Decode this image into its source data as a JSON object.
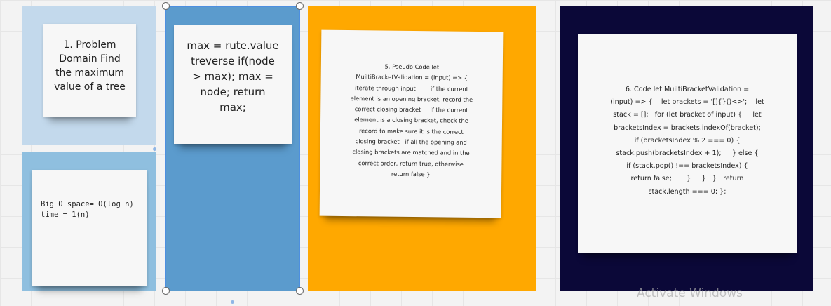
{
  "canvas": {
    "colors": {
      "light_blue_top": "#c3d9ec",
      "light_blue_bottom": "#8fbfdf",
      "mid_blue": "#5b9bcd",
      "orange": "#ffa800",
      "navy": "#0b0838",
      "note": "#f7f7f7",
      "selection": "#4d8fe0"
    }
  },
  "notes": {
    "problem_domain": "1. Problem\nDomain Find\nthe maximum\nvalue of a tree",
    "big_o": "Big O space= O(log n)\ntime = 1(n)",
    "algorithm": "max = rute.value\ntreverse if(node\n> max); max =\nnode; return\nmax;",
    "pseudo_code": "5. Pseudo Code let\nMuiltiBracketValidation = (input) => {\niterate through input        if the current\nelement is an opening bracket, record the\ncorrect closing bracket     if the current\nelement is a closing bracket, check the\nrecord to make sure it is the correct\nclosing bracket   if all the opening and\nclosing brackets are matched and in the\ncorrect order, return true, otherwise\nreturn false }",
    "code": "6. Code let MuiltiBracketValidation =\n(input) => {    let brackets = '[]{}()<>';    let\nstack = [];   for (let bracket of input) {     let\nbracketsIndex = brackets.indexOf(bracket);\nif (bracketsIndex % 2 === 0) {\nstack.push(bracketsIndex + 1);     } else {\nif (stack.pop() !== bracketsIndex) {\nreturn false;       }     }   }   return\nstack.length === 0; };"
  },
  "watermark": "Activate Windows"
}
